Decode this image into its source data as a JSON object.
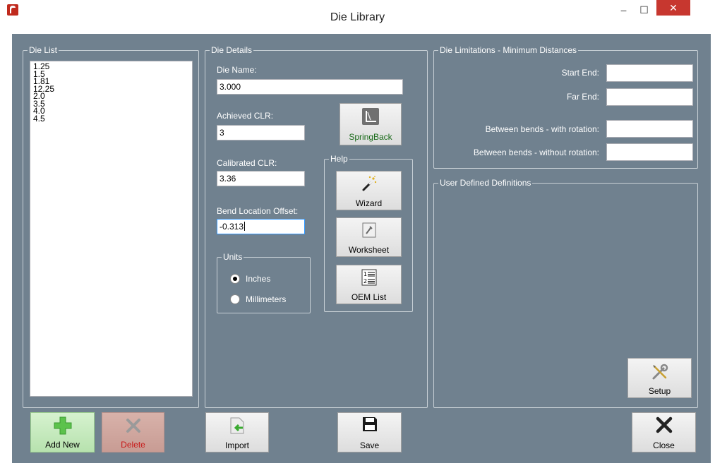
{
  "window": {
    "title": "Die Library",
    "minimize_glyph": "–",
    "maximize_glyph": "☐",
    "close_glyph": "✕",
    "accent_close": "#c7372f",
    "client_bg": "#70818f"
  },
  "die_list": {
    "legend": "Die List",
    "items": [
      "1.25",
      "1.5",
      "1.81",
      "12.25",
      "2.0",
      "3.5",
      "4.0",
      "4.5"
    ]
  },
  "die_details": {
    "legend": "Die Details",
    "die_name_label": "Die Name:",
    "die_name_value": "3.000",
    "achieved_clr_label": "Achieved CLR:",
    "achieved_clr_value": "3",
    "calibrated_clr_label": "Calibrated CLR:",
    "calibrated_clr_value": "3.36",
    "bend_offset_label": "Bend Location Offset:",
    "bend_offset_value": "-0.313",
    "springback_label": "SpringBack",
    "units": {
      "legend": "Units",
      "options": [
        "Inches",
        "Millimeters"
      ],
      "selected": "Inches"
    },
    "help": {
      "legend": "Help",
      "wizard_label": "Wizard",
      "worksheet_label": "Worksheet",
      "oem_list_label": "OEM List"
    }
  },
  "limitations": {
    "legend": "Die Limitations - Minimum Distances",
    "start_end_label": "Start End:",
    "start_end_value": "",
    "far_end_label": "Far End:",
    "far_end_value": "",
    "with_rotation_label": "Between bends - with rotation:",
    "with_rotation_value": "",
    "without_rotation_label": "Between bends - without rotation:",
    "without_rotation_value": ""
  },
  "user_defined": {
    "legend": "User Defined Definitions",
    "setup_label": "Setup"
  },
  "bottom_bar": {
    "add_new_label": "Add New",
    "delete_label": "Delete",
    "import_label": "Import",
    "save_label": "Save",
    "close_label": "Close"
  }
}
